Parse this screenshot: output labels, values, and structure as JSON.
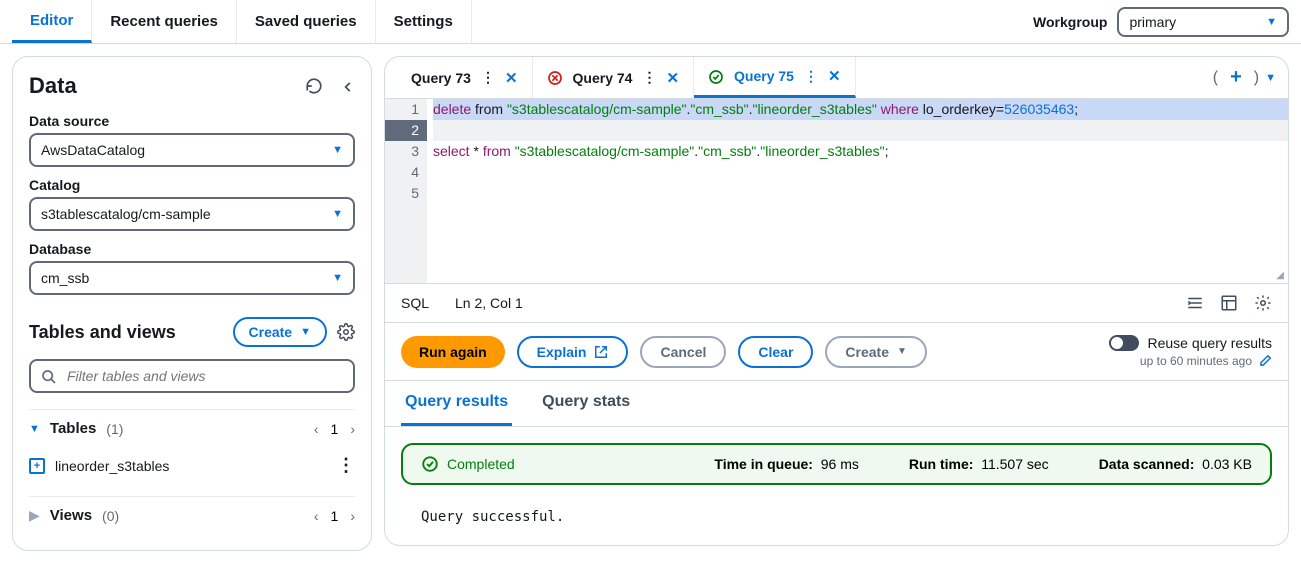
{
  "nav": {
    "tabs": [
      "Editor",
      "Recent queries",
      "Saved queries",
      "Settings"
    ],
    "active": 0
  },
  "workgroup": {
    "label": "Workgroup",
    "value": "primary"
  },
  "sidebar": {
    "title": "Data",
    "data_source": {
      "label": "Data source",
      "value": "AwsDataCatalog"
    },
    "catalog": {
      "label": "Catalog",
      "value": "s3tablescatalog/cm-sample"
    },
    "database": {
      "label": "Database",
      "value": "cm_ssb"
    },
    "tv_title": "Tables and views",
    "create_label": "Create",
    "filter_placeholder": "Filter tables and views",
    "tables": {
      "label": "Tables",
      "count": "(1)",
      "page": "1",
      "items": [
        "lineorder_s3tables"
      ]
    },
    "views": {
      "label": "Views",
      "count": "(0)",
      "page": "1"
    }
  },
  "query_tabs": {
    "tabs": [
      {
        "label": "Query 73",
        "status": "none"
      },
      {
        "label": "Query 74",
        "status": "error"
      },
      {
        "label": "Query 75",
        "status": "ok"
      }
    ],
    "active": 2
  },
  "editor": {
    "line_numbers": [
      "1",
      "2",
      "3",
      "4",
      "5"
    ],
    "current_line": 2,
    "line1": {
      "t1": "delete",
      "t2": " from ",
      "t3": "\"s3tablescatalog/cm-sample\"",
      "d1": ".",
      "t4": "\"cm_ssb\"",
      "d2": ".",
      "t5": "\"lineorder_s3tables\"",
      "t6": " where ",
      "t7": "lo_orderkey",
      "t8": "=",
      "t9": "526035463",
      "t10": ";"
    },
    "line3": {
      "t1": "select",
      "t2": " * ",
      "t3": "from ",
      "t4": "\"s3tablescatalog/cm-sample\"",
      "d1": ".",
      "t5": "\"cm_ssb\"",
      "d2": ".",
      "t6": "\"lineorder_s3tables\"",
      "t7": ";"
    }
  },
  "status_bar": {
    "lang": "SQL",
    "pos": "Ln 2, Col 1"
  },
  "actions": {
    "run": "Run again",
    "explain": "Explain",
    "cancel": "Cancel",
    "clear": "Clear",
    "create": "Create",
    "reuse_label": "Reuse query results",
    "reuse_sub": "up to 60 minutes ago"
  },
  "result_tabs": {
    "results": "Query results",
    "stats": "Query stats",
    "active": 0
  },
  "banner": {
    "status": "Completed",
    "queue_label": "Time in queue:",
    "queue_value": "96 ms",
    "runtime_label": "Run time:",
    "runtime_value": "11.507 sec",
    "scanned_label": "Data scanned:",
    "scanned_value": "0.03 KB"
  },
  "result_message": "Query successful."
}
